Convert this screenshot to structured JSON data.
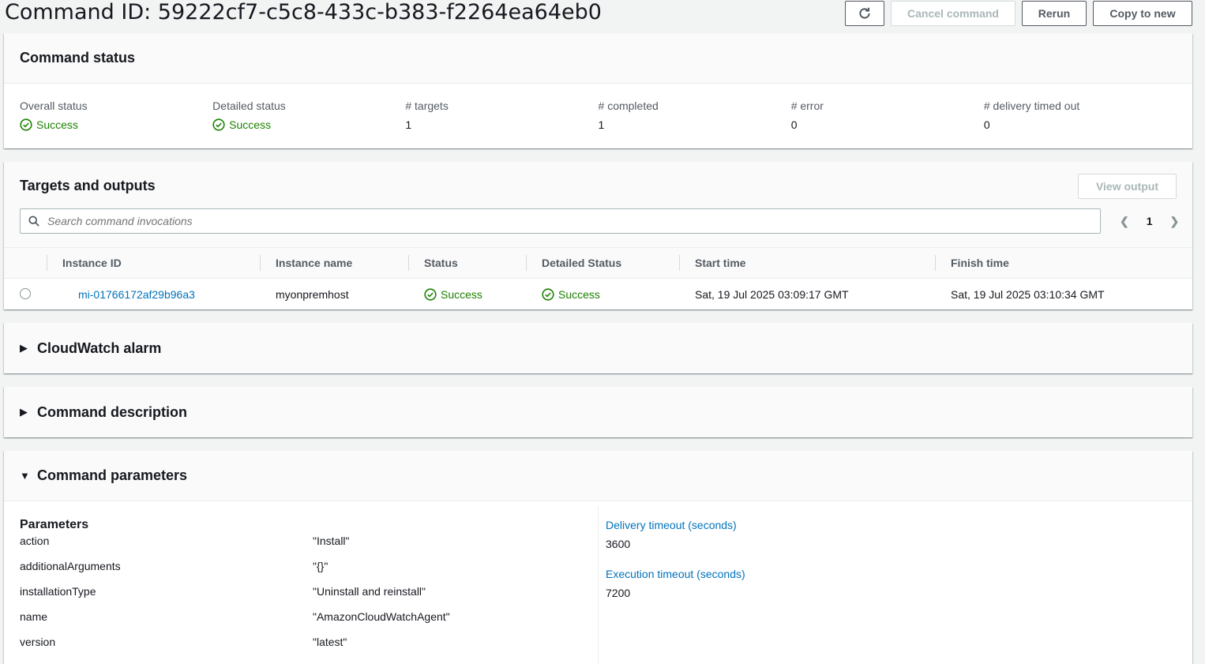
{
  "header": {
    "title": "Command ID: 59222cf7-c5c8-433c-b383-f2264ea64eb0",
    "buttons": {
      "cancel": "Cancel command",
      "rerun": "Rerun",
      "copy": "Copy to new"
    }
  },
  "command_status": {
    "title": "Command status",
    "fields": [
      {
        "label": "Overall status",
        "value": "Success"
      },
      {
        "label": "Detailed status",
        "value": "Success"
      },
      {
        "label": "# targets",
        "value": "1"
      },
      {
        "label": "# completed",
        "value": "1"
      },
      {
        "label": "# error",
        "value": "0"
      },
      {
        "label": "# delivery timed out",
        "value": "0"
      }
    ]
  },
  "targets": {
    "title": "Targets and outputs",
    "view_output": "View output",
    "search_placeholder": "Search command invocations",
    "page": "1",
    "columns": [
      "Instance ID",
      "Instance name",
      "Status",
      "Detailed Status",
      "Start time",
      "Finish time"
    ],
    "rows": [
      {
        "instance_id": "mi-01766172af29b96a3",
        "instance_name": "myonpremhost",
        "status": "Success",
        "detailed_status": "Success",
        "start_time": "Sat, 19 Jul 2025 03:09:17 GMT",
        "finish_time": "Sat, 19 Jul 2025 03:10:34 GMT"
      }
    ]
  },
  "cloudwatch": {
    "title": "CloudWatch alarm"
  },
  "description": {
    "title": "Command description"
  },
  "parameters": {
    "title": "Command parameters",
    "subtitle": "Parameters",
    "items": [
      {
        "name": "action",
        "value": "\"Install\""
      },
      {
        "name": "additionalArguments",
        "value": "\"{}\""
      },
      {
        "name": "installationType",
        "value": "\"Uninstall and reinstall\""
      },
      {
        "name": "name",
        "value": "\"AmazonCloudWatchAgent\""
      },
      {
        "name": "version",
        "value": "\"latest\""
      }
    ],
    "delivery_timeout_label": "Delivery timeout (seconds)",
    "delivery_timeout_value": "3600",
    "execution_timeout_label": "Execution timeout (seconds)",
    "execution_timeout_value": "7200"
  },
  "colors": {
    "success": "#1d8102",
    "link": "#0073bb"
  }
}
